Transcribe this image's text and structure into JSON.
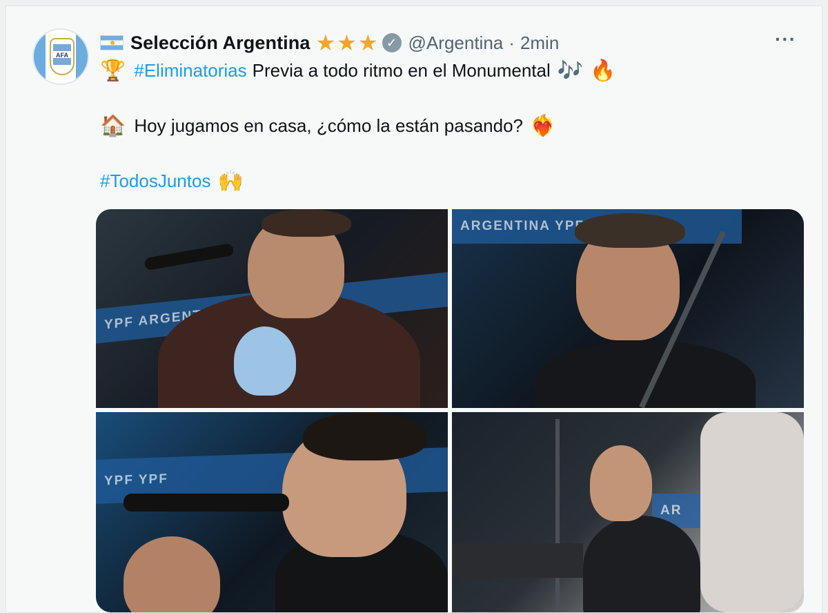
{
  "tweet": {
    "display_name": "Selección Argentina",
    "handle": "@Argentina",
    "separator": "·",
    "time": "2min",
    "more_label": "···",
    "avatar_text": "AFA",
    "verified_glyph": "✓",
    "star_glyph": "★",
    "stars_count": 3,
    "lines": {
      "line1": {
        "emoji": "🏆",
        "hashtag": "#Eliminatorias",
        "text": "Previa a todo ritmo en el Monumental",
        "emoji_after_1": "🎶",
        "emoji_after_2": "🔥"
      },
      "line2": {
        "emoji": "🏠",
        "text": "Hoy jugamos en casa, ¿cómo la están pasando?",
        "emoji_after": "❤️‍🔥"
      },
      "line3": {
        "hashtag": "#TodosJuntos",
        "emoji_after": "🙌"
      }
    },
    "photos": {
      "p1": {
        "banner": "YPF  ARGENTINA"
      },
      "p2": {
        "banner": "ARGENTINA   YPF"
      },
      "p3": {
        "banner": "YPF   YPF"
      },
      "p4": {
        "banner": "AR"
      }
    }
  },
  "colors": {
    "hashtag": "#1d9bf0",
    "stars": "#f4a52a",
    "verified": "#8899a6",
    "muted_text": "#536471"
  },
  "icons": {
    "flag": "argentina-flag-icon",
    "verified": "verified-badge-icon",
    "more": "more-options-icon"
  }
}
